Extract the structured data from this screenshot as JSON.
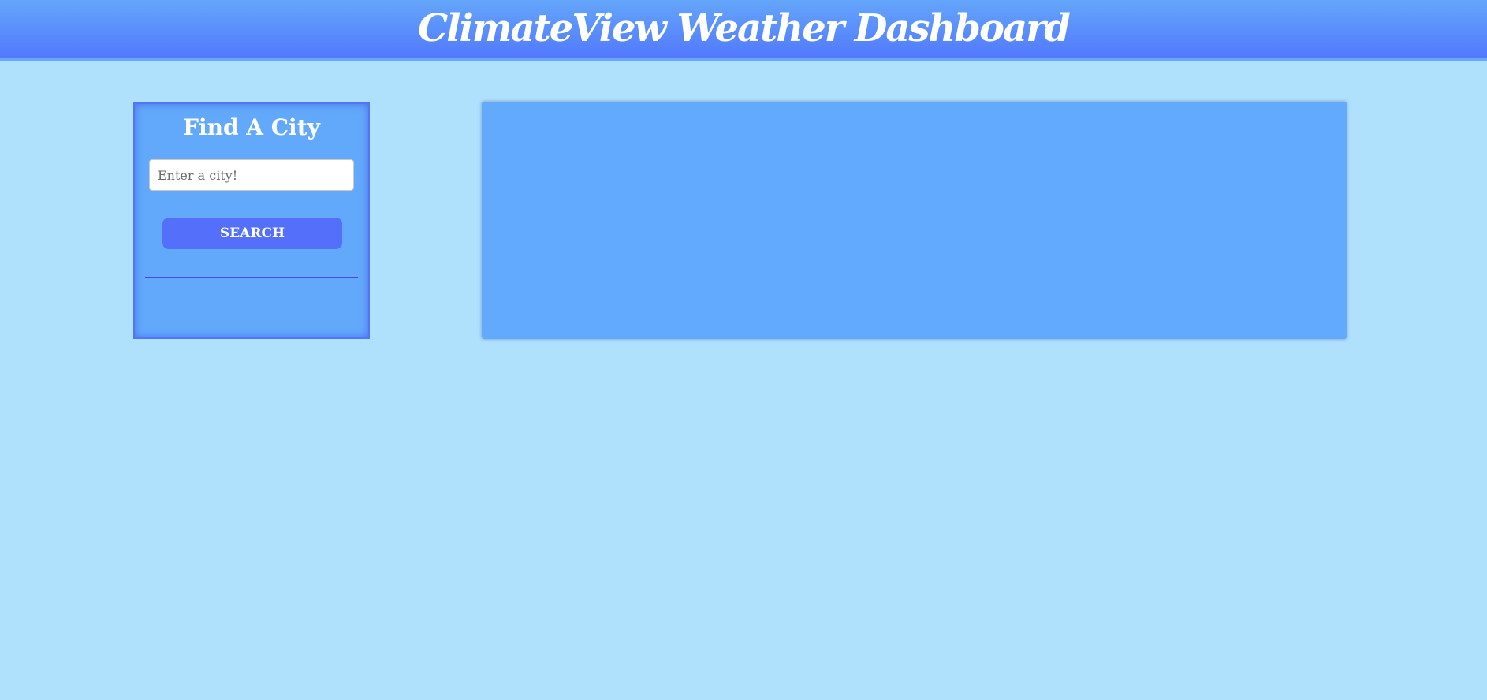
{
  "header": {
    "title": "ClimateView Weather Dashboard"
  },
  "sidebar": {
    "title": "Find A City",
    "search": {
      "placeholder": "Enter a city!",
      "value": ""
    },
    "search_button_label": "SEARCH",
    "history": []
  },
  "main": {
    "content": ""
  },
  "colors": {
    "page_background": "#afe0fc",
    "header_gradient_top": "#64a6fb",
    "header_gradient_bottom": "#5279fd",
    "panel_background": "#62a9fb",
    "button_background": "#546ffa",
    "divider": "#4f46d8",
    "text": "#ffffff"
  }
}
